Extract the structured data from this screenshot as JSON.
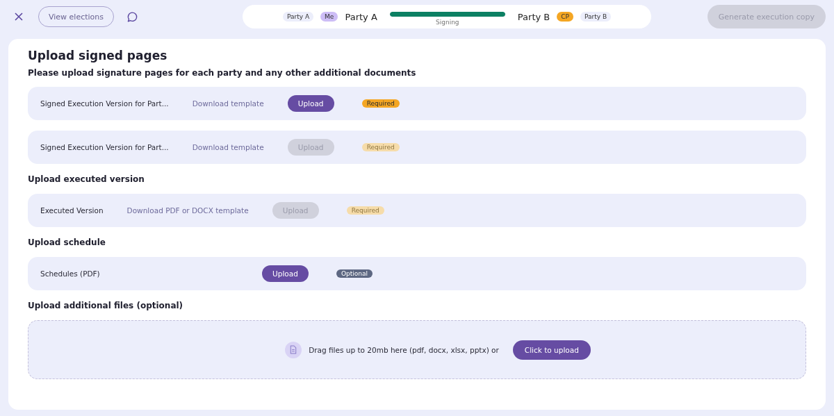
{
  "header": {
    "view_button": "View elections",
    "progress": {
      "left_tag": "Party A",
      "left_role": "Me",
      "left_name": "Party A",
      "level": 1,
      "status": "Signing",
      "right_name": "Party B",
      "right_role": "CP",
      "right_tag": "Party B"
    },
    "generate_button": {
      "label": "Generate execution copy",
      "disabled": true
    }
  },
  "card": {
    "title": "Upload signed pages",
    "subtitle": "Please upload signature pages for each party and any other additional documents",
    "sections": [
      {
        "rows": [
          {
            "label": "Signed Execution Version for Part...",
            "link": "Download template",
            "upload": {
              "label": "Upload",
              "disabled": false
            },
            "badge": {
              "label": "Required",
              "kind": "required",
              "disabled": false
            }
          },
          {
            "label": "Signed Execution Version for Part...",
            "link": "Download template",
            "upload": {
              "label": "Upload",
              "disabled": true
            },
            "badge": {
              "label": "Required",
              "kind": "required",
              "disabled": true
            }
          }
        ]
      },
      {
        "heading": "Upload executed version",
        "rows": [
          {
            "label": "Executed Version",
            "link": "Download PDF or DOCX template",
            "upload": {
              "label": "Upload",
              "disabled": true
            },
            "badge": {
              "label": "Required",
              "kind": "required",
              "disabled": true
            }
          }
        ]
      },
      {
        "heading": "Upload schedule",
        "rows": [
          {
            "label": "Schedules (PDF)",
            "upload": {
              "label": "Upload",
              "disabled": false
            },
            "badge": {
              "label": "Optional",
              "kind": "optional",
              "disabled": false
            }
          }
        ]
      },
      {
        "heading": "Upload additional files (optional)",
        "dropzone": {
          "text": "Drag files up to 20mb here (pdf, docx, xlsx, pptx) or",
          "button": "Click to upload"
        }
      }
    ]
  }
}
